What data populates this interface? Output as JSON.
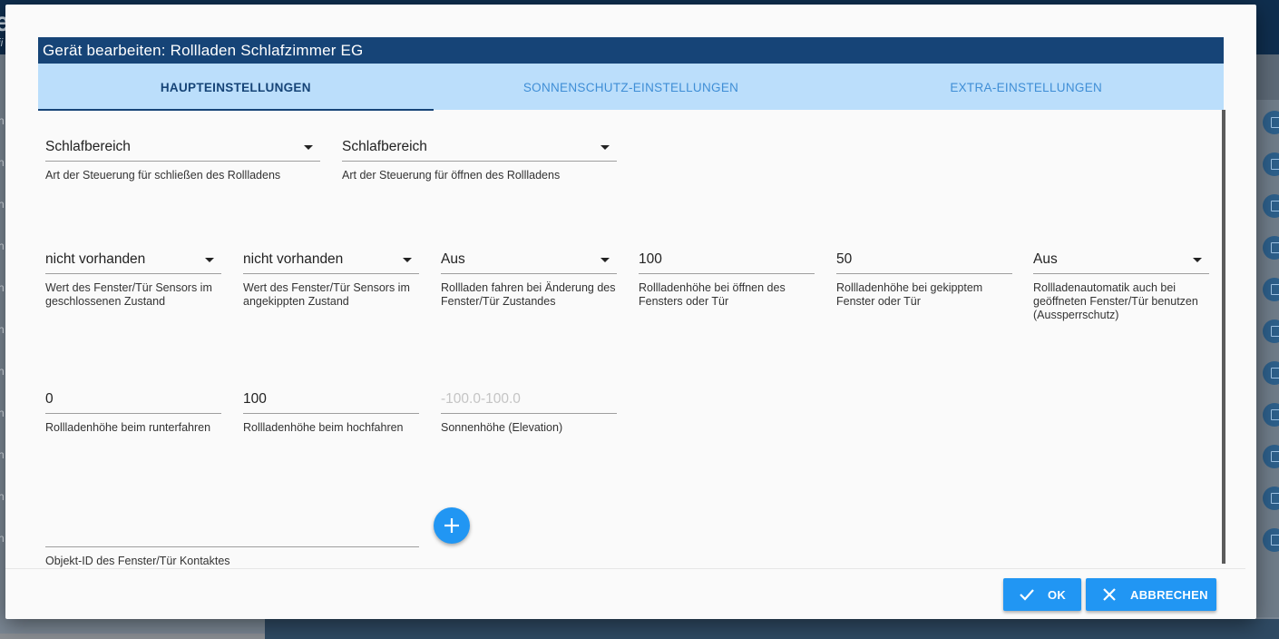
{
  "background": {
    "title_fragment": "e",
    "subtitle_fragment": "ii",
    "row_letters": [
      "n",
      "n",
      "n",
      "n",
      "n",
      "n",
      "n",
      "n",
      "n",
      "n",
      "n"
    ]
  },
  "dialog": {
    "title": "Gerät bearbeiten: Rollladen Schlafzimmer EG",
    "tabs": [
      {
        "label": "HAUPTEINSTELLUNGEN",
        "active": true
      },
      {
        "label": "SONNENSCHUTZ-EINSTELLUNGEN",
        "active": false
      },
      {
        "label": "EXTRA-EINSTELLUNGEN",
        "active": false
      }
    ],
    "fields": {
      "close_control": {
        "value": "Schlafbereich",
        "helper": "Art der Steuerung für schließen des Rollladens"
      },
      "open_control": {
        "value": "Schlafbereich",
        "helper": "Art der Steuerung für öffnen des Rollladens"
      },
      "sensor_closed": {
        "value": "nicht vorhanden",
        "helper": "Wert des Fenster/Tür Sensors im geschlossenen Zustand"
      },
      "sensor_tilted": {
        "value": "nicht vorhanden",
        "helper": "Wert des Fenster/Tür Sensors im angekippten Zustand"
      },
      "move_on_change": {
        "value": "Aus",
        "helper": "Rollladen fahren bei Änderung des Fenster/Tür Zustandes"
      },
      "height_open_window": {
        "value": "100",
        "helper": "Rollladenhöhe bei öffnen des Fensters oder Tür"
      },
      "height_tilted_window": {
        "value": "50",
        "helper": "Rollladenhöhe bei gekipptem Fenster oder Tür"
      },
      "lockout_protection": {
        "value": "Aus",
        "helper": "Rollladenautomatik auch bei geöffneten Fenster/Tür benutzen (Aussperrschutz)"
      },
      "height_down": {
        "value": "0",
        "helper": "Rollladenhöhe beim runterfahren"
      },
      "height_up": {
        "value": "100",
        "helper": "Rollladenhöhe beim hochfahren"
      },
      "elevation": {
        "placeholder": "-100.0-100.0",
        "helper": "Sonnenhöhe (Elevation)"
      },
      "contact_object_id": {
        "value": "",
        "helper": "Objekt-ID des Fenster/Tür Kontaktes"
      }
    },
    "buttons": {
      "ok_label": "OK",
      "cancel_label": "ABBRECHEN"
    }
  }
}
